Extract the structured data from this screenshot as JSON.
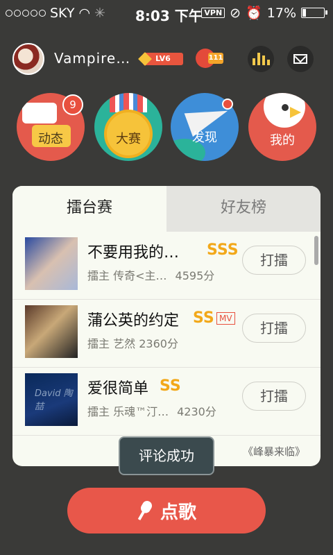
{
  "status_bar": {
    "carrier": "SKY",
    "time": "8:03 下午",
    "vpn": "VPN",
    "battery": "17%"
  },
  "header": {
    "username": "Vampire…",
    "level": "LV6",
    "flower_count": "111"
  },
  "nav": {
    "items": [
      {
        "label": "动态",
        "badge": "9"
      },
      {
        "label": "大赛"
      },
      {
        "label": "发现"
      },
      {
        "label": "我的"
      }
    ]
  },
  "tabs": {
    "active": "擂台赛",
    "inactive": "好友榜"
  },
  "list": [
    {
      "title": "不要用我的…",
      "grade": "SSS",
      "mv": "",
      "host_prefix": "擂主",
      "host": "传奇<主…",
      "score": "4595分",
      "button": "打擂"
    },
    {
      "title": "蒲公英的约定",
      "grade": "SS",
      "mv": "MV",
      "host_prefix": "擂主",
      "host": "艺然",
      "score": "2360分",
      "button": "打擂"
    },
    {
      "title": "爱很简单",
      "grade": "SS",
      "mv": "",
      "host_prefix": "擂主",
      "host": "乐魂™汀…",
      "score": "4230分",
      "button": "打擂"
    }
  ],
  "thumb3_text": "David 陶喆",
  "footer_text": "《峰暴来临》",
  "toast": "评论成功",
  "sing_button": "点歌",
  "colors": {
    "background": "#3a3a38",
    "accent_red": "#e8574a",
    "grade_gold": "#f2a81a"
  }
}
